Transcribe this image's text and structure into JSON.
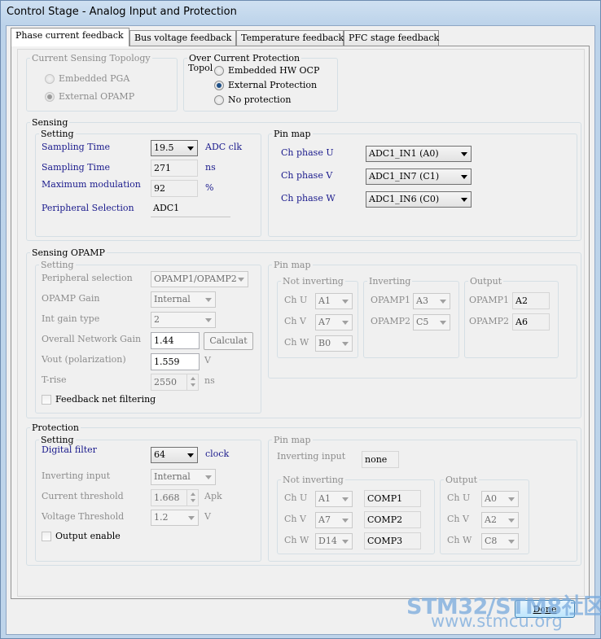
{
  "window": {
    "title": "Control Stage - Analog Input and Protection"
  },
  "tabs": [
    {
      "label": "Phase current feedback",
      "active": true
    },
    {
      "label": "Bus voltage feedback",
      "active": false
    },
    {
      "label": "Temperature feedback",
      "active": false
    },
    {
      "label": "PFC stage feedback",
      "active": false
    }
  ],
  "topology": {
    "title": "Current Sensing Topology",
    "options": [
      "Embedded PGA",
      "External OPAMP"
    ],
    "selected": "External OPAMP"
  },
  "ocp": {
    "title": "Over Current Protection",
    "topol_label": "Topol",
    "options": [
      "Embedded HW OCP",
      "External Protection",
      "No protection"
    ],
    "selected": "External Protection"
  },
  "sensing": {
    "title": "Sensing",
    "setting_title": "Setting",
    "sampling_time_label": "Sampling Time",
    "sampling_time_value": "19.5",
    "sampling_time_unit": "ADC clk",
    "sampling_time2_label": "Sampling Time",
    "sampling_time2_value": "271",
    "sampling_time2_unit": "ns",
    "max_mod_label": "Maximum modulation",
    "max_mod_value": "92",
    "max_mod_unit": "%",
    "peripheral_label": "Peripheral Selection",
    "peripheral_value": "ADC1",
    "pinmap_title": "Pin map",
    "phase_u_label": "Ch phase U",
    "phase_u_value": "ADC1_IN1 (A0)",
    "phase_v_label": "Ch phase V",
    "phase_v_value": "ADC1_IN7 (C1)",
    "phase_w_label": "Ch phase W",
    "phase_w_value": "ADC1_IN6 (C0)"
  },
  "opamp": {
    "title": "Sensing OPAMP",
    "setting_title": "Setting",
    "peripheral_label": "Peripheral selection",
    "peripheral_value": "OPAMP1/OPAMP2",
    "gain_label": "OPAMP Gain",
    "gain_value": "Internal",
    "int_gain_label": "Int gain type",
    "int_gain_value": "2",
    "overall_gain_label": "Overall Network Gain",
    "overall_gain_value": "1.44",
    "calc_button": "Calculat",
    "vout_label": "Vout (polarization)",
    "vout_value": "1.559",
    "vout_unit": "V",
    "trise_label": "T-rise",
    "trise_value": "2550",
    "trise_unit": "ns",
    "feedback_filter_label": "Feedback net filtering",
    "pinmap_title": "Pin map",
    "noninv_title": "Not inverting",
    "inv_title": "Inverting",
    "out_title": "Output",
    "ch_u": "Ch U",
    "ch_u_value": "A1",
    "ch_v": "Ch V",
    "ch_v_value": "A7",
    "ch_w": "Ch W",
    "ch_w_value": "B0",
    "inv_opamp1": "OPAMP1",
    "inv_opamp1_value": "A3",
    "inv_opamp2": "OPAMP2",
    "inv_opamp2_value": "C5",
    "out_opamp1": "OPAMP1",
    "out_opamp1_value": "A2",
    "out_opamp2": "OPAMP2",
    "out_opamp2_value": "A6"
  },
  "protection": {
    "title": "Protection",
    "setting_title": "Setting",
    "digital_filter_label": "Digital filter",
    "digital_filter_value": "64",
    "digital_filter_unit": "clock",
    "inv_input_label": "Inverting input",
    "inv_input_value": "Internal",
    "current_thr_label": "Current threshold",
    "current_thr_value": "1.668",
    "current_thr_unit": "Apk",
    "voltage_thr_label": "Voltage Threshold",
    "voltage_thr_value": "1.2",
    "voltage_thr_unit": "V",
    "output_enable_label": "Output enable",
    "pinmap_title": "Pin map",
    "pin_inv_label": "Inverting input",
    "pin_inv_value": "none",
    "noninv_title": "Not inverting",
    "out_title": "Output",
    "ni_u": "Ch U",
    "ni_u_value": "A1",
    "ni_u_comp": "COMP1",
    "ni_v": "Ch V",
    "ni_v_value": "A7",
    "ni_v_comp": "COMP2",
    "ni_w": "Ch W",
    "ni_w_value": "D14",
    "ni_w_comp": "COMP3",
    "out_u": "Ch U",
    "out_u_value": "A0",
    "out_v": "Ch V",
    "out_v_value": "A2",
    "out_w": "Ch W",
    "out_w_value": "C8"
  },
  "footer": {
    "done_label": "Done",
    "watermark_1": "STM32/STM8社区",
    "watermark_2": "www.stmcu.org"
  }
}
